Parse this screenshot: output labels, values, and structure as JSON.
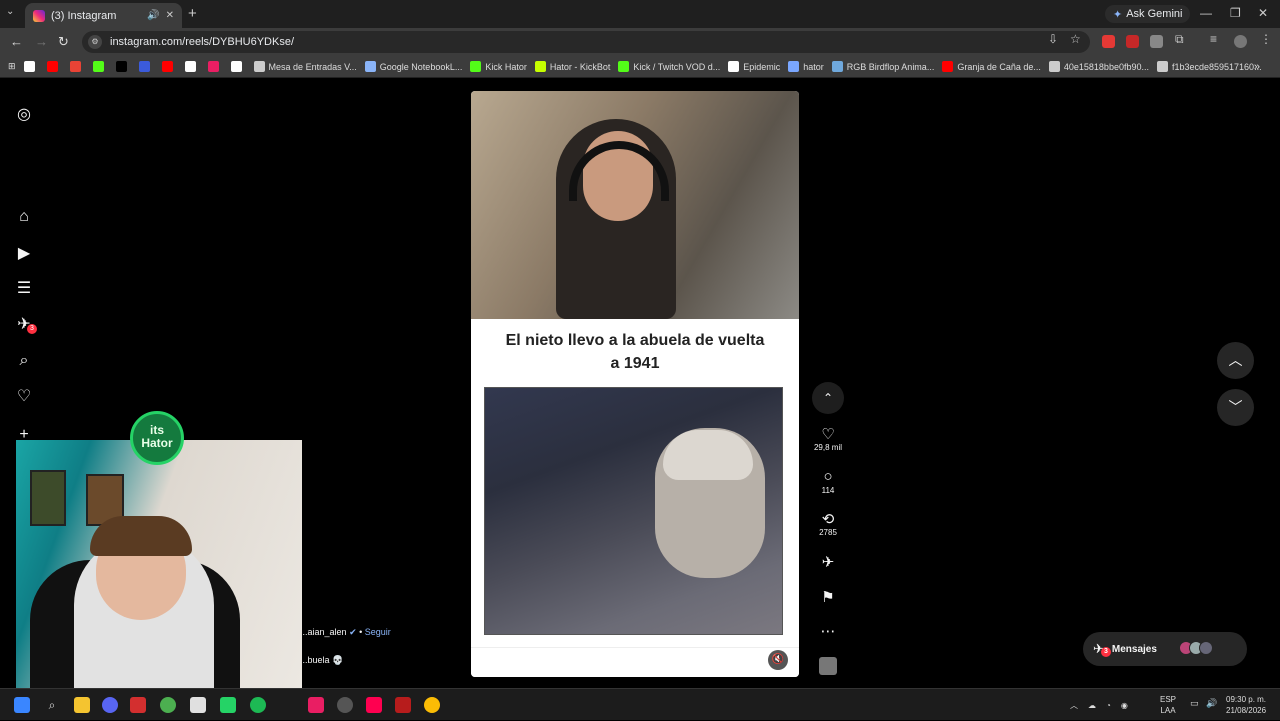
{
  "browser": {
    "tab_title": "(3) Instagram",
    "url": "instagram.com/reels/DYBHU6YDKse/",
    "gemini_label": "Ask Gemini",
    "bookmarks": [
      {
        "label": "",
        "color": "#ffffff"
      },
      {
        "label": "",
        "color": "#ff0000"
      },
      {
        "label": "",
        "color": "#ea4335"
      },
      {
        "label": "",
        "color": "#53fc18"
      },
      {
        "label": "",
        "color": "#000000"
      },
      {
        "label": "",
        "color": "#3b5bdb"
      },
      {
        "label": "",
        "color": "#ff0000"
      },
      {
        "label": "",
        "color": "#ffffff"
      },
      {
        "label": "",
        "color": "#e91e63"
      },
      {
        "label": "",
        "color": "#ffffff"
      },
      {
        "label": "Mesa de Entradas V...",
        "color": "#cccccc"
      },
      {
        "label": "Google NotebookL...",
        "color": "#8ab4f8"
      },
      {
        "label": "Kick Hator",
        "color": "#53fc18"
      },
      {
        "label": "Hator - KickBot",
        "color": "#c6ff00"
      },
      {
        "label": "Kick / Twitch VOD d...",
        "color": "#53fc18"
      },
      {
        "label": "Epidemic",
        "color": "#ffffff"
      },
      {
        "label": "hator",
        "color": "#7aa7ff"
      },
      {
        "label": "RGB Birdflop Anima...",
        "color": "#6fa8dc"
      },
      {
        "label": "Granja de Caña de...",
        "color": "#ff0000"
      },
      {
        "label": "40e15818bbe0fb90...",
        "color": "#cccccc"
      },
      {
        "label": "f1b3ecde859517160...",
        "color": "#cccccc"
      }
    ]
  },
  "instagram": {
    "reel_caption": "El nieto llevo a la abuela de vuelta a 1941",
    "likes": "29,8 mil",
    "comments": "114",
    "reposts": "2785",
    "author": "...aian_alen",
    "follow_label": "Seguir",
    "caption_snippet": "...buela 💀",
    "messages_label": "Mensajes",
    "messages_badge": "3",
    "notifications_badge": "3"
  },
  "overlay": {
    "logo_line1": "its",
    "logo_line2": "Hator"
  },
  "taskbar": {
    "lang_line1": "ESP",
    "lang_line2": "LAA",
    "time": "09:30 p. m.",
    "date": "21/08/2026"
  },
  "colors": {
    "accent_blue": "#8ab4f8",
    "badge_red": "#ff3040"
  }
}
